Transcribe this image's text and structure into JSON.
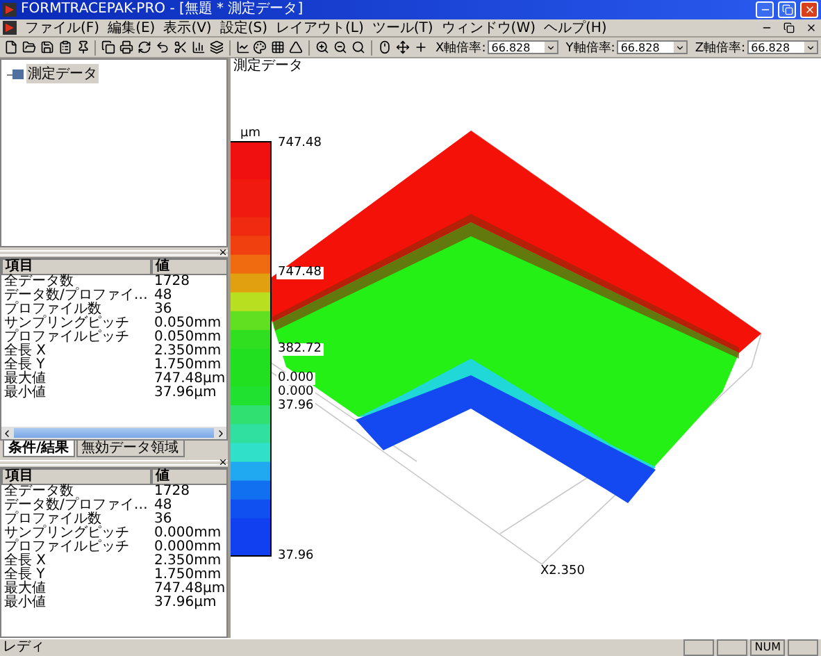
{
  "window": {
    "title": "FORMTRACEPAK-PRO - [無題 * 測定データ]"
  },
  "menu": [
    "ファイル(F)",
    "編集(E)",
    "表示(V)",
    "設定(S)",
    "レイアウト(L)",
    "ツール(T)",
    "ウィンドウ(W)",
    "ヘルプ(H)"
  ],
  "zoom_fields": [
    {
      "label": "X軸倍率:",
      "value": "66.828"
    },
    {
      "label": "Y軸倍率:",
      "value": "66.828"
    },
    {
      "label": "Z軸倍率:",
      "value": "66.828"
    }
  ],
  "tree": [
    {
      "label": "測定データ"
    }
  ],
  "property_panels": [
    {
      "columns": [
        "項目",
        "値"
      ],
      "rows": [
        [
          "全データ数",
          "1728"
        ],
        [
          "データ数/プロファイ…",
          "48"
        ],
        [
          "プロファイル数",
          "36"
        ],
        [
          "サンプリングピッチ",
          "0.050mm"
        ],
        [
          "プロファイルピッチ",
          "0.050mm"
        ],
        [
          "全長 X",
          "2.350mm"
        ],
        [
          "全長 Y",
          "1.750mm"
        ],
        [
          "最大値",
          "747.48µm"
        ],
        [
          "最小値",
          "37.96µm"
        ]
      ],
      "tabs": [
        {
          "label": "条件/結果",
          "selected": true
        },
        {
          "label": "無効データ領域",
          "selected": false
        }
      ]
    },
    {
      "columns": [
        "項目",
        "値"
      ],
      "rows": [
        [
          "全データ数",
          "1728"
        ],
        [
          "データ数/プロファイ…",
          "48"
        ],
        [
          "プロファイル数",
          "36"
        ],
        [
          "サンプリングピッチ",
          "0.000mm"
        ],
        [
          "プロファイルピッチ",
          "0.000mm"
        ],
        [
          "全長 X",
          "2.350mm"
        ],
        [
          "全長 Y",
          "1.750mm"
        ],
        [
          "最大値",
          "747.48µm"
        ],
        [
          "最小値",
          "37.96µm"
        ]
      ]
    }
  ],
  "document": {
    "title": "測定データ",
    "legend": {
      "unit": "µm",
      "labels": [
        "747.48",
        "382.72",
        "37.96"
      ]
    },
    "plot_labels": [
      "747.48",
      "0.000",
      "0.000",
      "37.96",
      "X2.350"
    ]
  },
  "status_bar": {
    "text": "レディ",
    "indicators": [
      "NUM"
    ]
  }
}
